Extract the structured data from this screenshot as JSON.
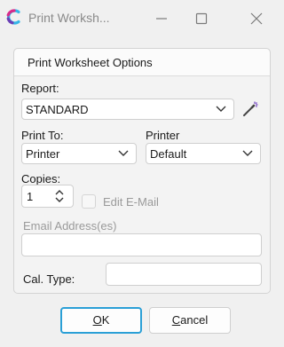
{
  "window": {
    "title": "Print Worksh...",
    "app_icon": "app-logo-icon",
    "controls": [
      "minimize-icon",
      "maximize-icon",
      "close-icon"
    ]
  },
  "group": {
    "title": "Print Worksheet Options"
  },
  "report": {
    "label": "Report:",
    "value": "STANDARD"
  },
  "print_to": {
    "label": "Print To:",
    "value": "Printer"
  },
  "printer": {
    "label": "Printer",
    "value": "Default"
  },
  "copies": {
    "label": "Copies:",
    "value": "1"
  },
  "edit_email": {
    "label": "Edit E-Mail",
    "checked": false
  },
  "email": {
    "label": "Email Address(es)",
    "value": ""
  },
  "cal_type": {
    "label": "Cal. Type:",
    "value": ""
  },
  "buttons": {
    "ok_mnemonic": "O",
    "ok_rest": "K",
    "cancel_mnemonic": "C",
    "cancel_rest": "ancel"
  },
  "colors": {
    "accent": "#2a9fd6",
    "logo_cyan": "#35b6e8",
    "logo_magenta": "#d92a8a",
    "logo_purple": "#6a3fb5"
  }
}
